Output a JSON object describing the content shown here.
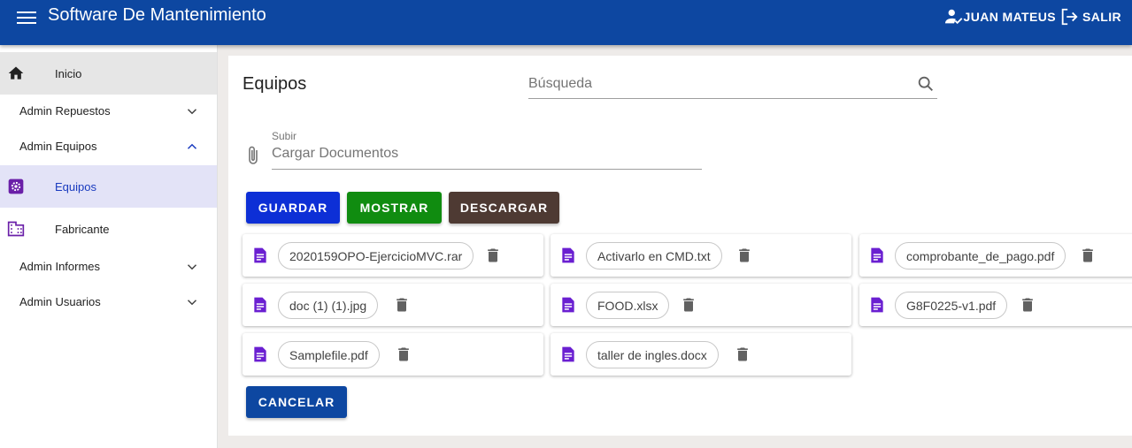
{
  "app": {
    "title": "Software De Mantenimiento",
    "user_name": "JUAN MATEUS",
    "logout_label": "SALIR"
  },
  "colors": {
    "appbar": "#0d47a1",
    "selected_nav_bg": "#e3e3f7",
    "file_icon": "#6a1fd1",
    "save": "#0d2fd6",
    "show": "#108c10",
    "download": "#4e3a33",
    "cancel": "#0d47a1"
  },
  "sidebar": {
    "home": "Inicio",
    "groups": {
      "repuestos": "Admin Repuestos",
      "equipos": "Admin Equipos",
      "informes": "Admin Informes",
      "usuarios": "Admin Usuarios"
    },
    "sub": {
      "equipos": "Equipos",
      "fabricante": "Fabricante"
    }
  },
  "main": {
    "title": "Equipos",
    "search_placeholder": "Búsqueda",
    "upload_label": "Subir",
    "upload_placeholder": "Cargar Documentos",
    "buttons": {
      "save": "GUARDAR",
      "show": "MOSTRAR",
      "download": "DESCARGAR",
      "cancel": "CANCELAR"
    },
    "files": [
      "2020159OPO-EjercicioMVC.rar",
      "Activarlo en CMD.txt",
      "comprobante_de_pago.pdf",
      "doc (1) (1).jpg",
      "FOOD.xlsx",
      "G8F0225-v1.pdf",
      "Samplefile.pdf",
      "taller de ingles.docx"
    ]
  },
  "icons": [
    "menu-icon",
    "user-check-icon",
    "logout-icon",
    "home-icon",
    "chevron-down-icon",
    "chevron-up-icon",
    "gear-icon",
    "building-icon",
    "search-icon",
    "paperclip-icon",
    "document-icon",
    "trash-icon"
  ]
}
